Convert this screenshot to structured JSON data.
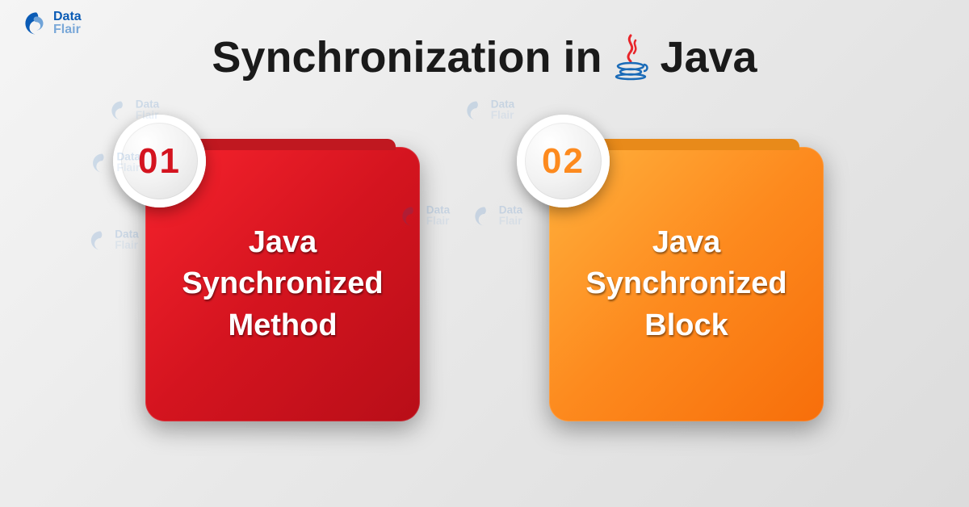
{
  "logo": {
    "data": "Data",
    "flair": "Flair"
  },
  "title": {
    "part1": "Synchronization in",
    "part2": "Java"
  },
  "cards": [
    {
      "number": "01",
      "line1": "Java",
      "line2": "Synchronized",
      "line3": "Method"
    },
    {
      "number": "02",
      "line1": "Java",
      "line2": "Synchronized",
      "line3": "Block"
    }
  ],
  "colors": {
    "red": "#d4141f",
    "orange": "#fd8a1e",
    "logoBlue": "#0a5bb5"
  }
}
